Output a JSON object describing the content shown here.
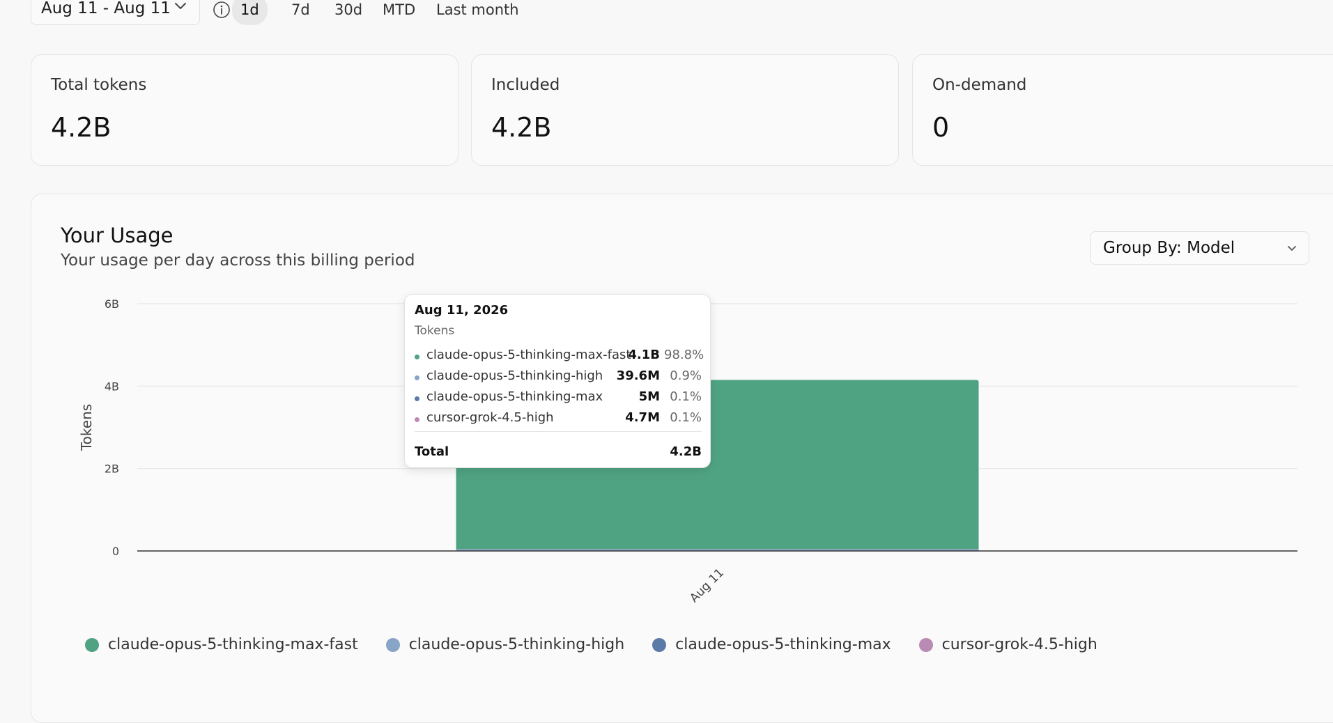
{
  "filters": {
    "date_range": "Aug 11 - Aug 11",
    "ranges": [
      "1d",
      "7d",
      "30d",
      "MTD",
      "Last month"
    ],
    "active_range": "1d"
  },
  "stats": [
    {
      "label": "Total tokens",
      "value": "4.2B"
    },
    {
      "label": "Included",
      "value": "4.2B"
    },
    {
      "label": "On-demand",
      "value": "0"
    }
  ],
  "usage": {
    "title": "Your Usage",
    "subtitle": "Your usage per day across this billing period",
    "group_by": "Group By: Model"
  },
  "tooltip": {
    "date": "Aug 11, 2026",
    "metric": "Tokens",
    "rows": [
      {
        "name": "claude-opus-5-thinking-max-fast",
        "amount": "4.1B",
        "pct": "98.8%"
      },
      {
        "name": "claude-opus-5-thinking-high",
        "amount": "39.6M",
        "pct": "0.9%"
      },
      {
        "name": "claude-opus-5-thinking-max",
        "amount": "5M",
        "pct": "0.1%"
      },
      {
        "name": "cursor-grok-4.5-high",
        "amount": "4.7M",
        "pct": "0.1%"
      }
    ],
    "total_label": "Total",
    "total_value": "4.2B"
  },
  "colors": {
    "claude-opus-5-thinking-max-fast": "#4fa383",
    "claude-opus-5-thinking-high": "#88a5c8",
    "claude-opus-5-thinking-max": "#5a7aa8",
    "cursor-grok-4.5-high": "#b98bb4"
  },
  "chart_data": {
    "type": "bar",
    "stacked": true,
    "categories": [
      "Aug 11"
    ],
    "ylabel": "Tokens",
    "ylim": [
      0,
      6000000000
    ],
    "yticks": [
      "0",
      "2B",
      "4B",
      "6B"
    ],
    "ytick_values": [
      0,
      2000000000,
      4000000000,
      6000000000
    ],
    "grid": true,
    "legend_position": "bottom",
    "series": [
      {
        "name": "claude-opus-5-thinking-max-fast",
        "values": [
          4100000000
        ]
      },
      {
        "name": "claude-opus-5-thinking-high",
        "values": [
          39600000
        ]
      },
      {
        "name": "claude-opus-5-thinking-max",
        "values": [
          5000000
        ]
      },
      {
        "name": "cursor-grok-4.5-high",
        "values": [
          4700000
        ]
      }
    ]
  }
}
